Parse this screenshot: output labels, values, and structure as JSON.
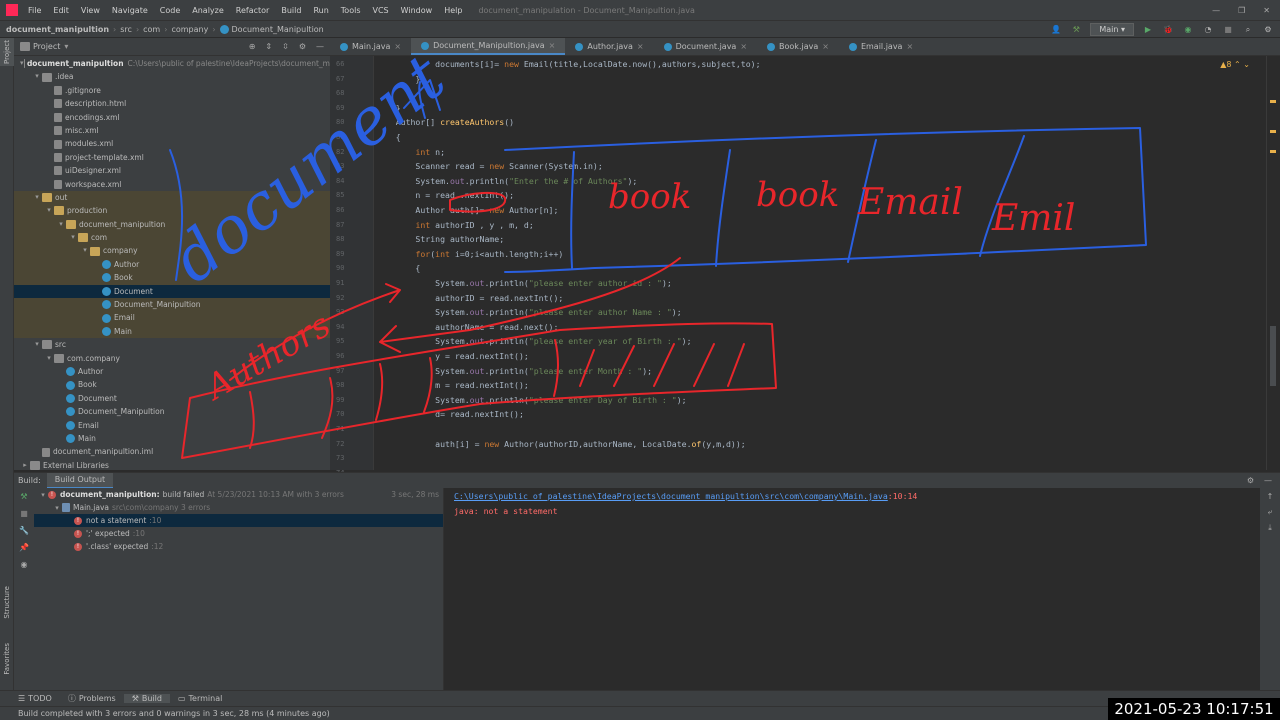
{
  "menu": [
    "File",
    "Edit",
    "View",
    "Navigate",
    "Code",
    "Analyze",
    "Refactor",
    "Build",
    "Run",
    "Tools",
    "VCS",
    "Window",
    "Help"
  ],
  "window_title": "document_manipulation - Document_Manipultion.java",
  "breadcrumbs": [
    "document_manipultion",
    "src",
    "com",
    "company",
    "Document_Manipultion"
  ],
  "run_config": "Main",
  "project_panel": {
    "title": "Project",
    "root_name": "document_manipultion",
    "root_path": "C:\\Users\\public of palestine\\IdeaProjects\\document_m",
    "items": [
      {
        "label": ".idea",
        "depth": 1,
        "kind": "folder",
        "expanded": true
      },
      {
        "label": ".gitignore",
        "depth": 2,
        "kind": "file"
      },
      {
        "label": "description.html",
        "depth": 2,
        "kind": "file"
      },
      {
        "label": "encodings.xml",
        "depth": 2,
        "kind": "file"
      },
      {
        "label": "misc.xml",
        "depth": 2,
        "kind": "file"
      },
      {
        "label": "modules.xml",
        "depth": 2,
        "kind": "file"
      },
      {
        "label": "project-template.xml",
        "depth": 2,
        "kind": "file"
      },
      {
        "label": "uiDesigner.xml",
        "depth": 2,
        "kind": "file"
      },
      {
        "label": "workspace.xml",
        "depth": 2,
        "kind": "file"
      },
      {
        "label": "out",
        "depth": 1,
        "kind": "folder-out",
        "expanded": true
      },
      {
        "label": "production",
        "depth": 2,
        "kind": "folder-out",
        "expanded": true
      },
      {
        "label": "document_manipultion",
        "depth": 3,
        "kind": "folder-out",
        "expanded": true
      },
      {
        "label": "com",
        "depth": 4,
        "kind": "folder-out",
        "expanded": true
      },
      {
        "label": "company",
        "depth": 5,
        "kind": "folder-out",
        "expanded": true
      },
      {
        "label": "Author",
        "depth": 6,
        "kind": "class-out"
      },
      {
        "label": "Book",
        "depth": 6,
        "kind": "class-out"
      },
      {
        "label": "Document",
        "depth": 6,
        "kind": "class-sel"
      },
      {
        "label": "Document_Manipultion",
        "depth": 6,
        "kind": "class-out"
      },
      {
        "label": "Email",
        "depth": 6,
        "kind": "class-out"
      },
      {
        "label": "Main",
        "depth": 6,
        "kind": "class-out"
      },
      {
        "label": "src",
        "depth": 1,
        "kind": "folder",
        "expanded": true
      },
      {
        "label": "com.company",
        "depth": 2,
        "kind": "folder",
        "expanded": true
      },
      {
        "label": "Author",
        "depth": 3,
        "kind": "class"
      },
      {
        "label": "Book",
        "depth": 3,
        "kind": "class"
      },
      {
        "label": "Document",
        "depth": 3,
        "kind": "class"
      },
      {
        "label": "Document_Manipultion",
        "depth": 3,
        "kind": "class"
      },
      {
        "label": "Email",
        "depth": 3,
        "kind": "class"
      },
      {
        "label": "Main",
        "depth": 3,
        "kind": "class"
      },
      {
        "label": "document_manipultion.iml",
        "depth": 1,
        "kind": "file"
      },
      {
        "label": "External Libraries",
        "depth": 0,
        "kind": "folder"
      }
    ]
  },
  "tabs": [
    {
      "label": "Main.java",
      "active": false
    },
    {
      "label": "Document_Manipultion.java",
      "active": true
    },
    {
      "label": "Author.java",
      "active": false
    },
    {
      "label": "Document.java",
      "active": false
    },
    {
      "label": "Book.java",
      "active": false
    },
    {
      "label": "Email.java",
      "active": false
    }
  ],
  "inspection": "8",
  "line_numbers": [
    "66",
    "67",
    "68",
    "69",
    "80",
    "81",
    "82",
    "83",
    "84",
    "85",
    "86",
    "87",
    "88",
    "89",
    "90",
    "91",
    "92",
    "93",
    "94",
    "95",
    "96",
    "97",
    "98",
    "99",
    "70",
    "71",
    "72",
    "73",
    "74",
    "75",
    "76",
    "77"
  ],
  "code_lines": [
    {
      "i": 0,
      "t": "            documents[i]= new Email(title,LocalDate.now(),authors,subject,to);"
    },
    {
      "i": 1,
      "t": "        }"
    },
    {
      "i": 3,
      "t": "    }"
    },
    {
      "i": 4,
      "t": "    Author[] createAuthors()"
    },
    {
      "i": 5,
      "t": "    {"
    },
    {
      "i": 6,
      "t": "        int n;"
    },
    {
      "i": 7,
      "t": "        Scanner read = new Scanner(System.in);"
    },
    {
      "i": 8,
      "t": "        System.out.println(\"Enter the # of Authors\");"
    },
    {
      "i": 9,
      "t": "        n = read .nextInt();"
    },
    {
      "i": 10,
      "t": "        Author auth[]= new Author[n];"
    },
    {
      "i": 11,
      "t": "        int authorID , y , m, d;"
    },
    {
      "i": 12,
      "t": "        String authorName;"
    },
    {
      "i": 13,
      "t": "        for(int i=0;i<auth.length;i++)"
    },
    {
      "i": 14,
      "t": "        {"
    },
    {
      "i": 15,
      "t": "            System.out.println(\"please enter author id : \");"
    },
    {
      "i": 16,
      "t": "            authorID = read.nextInt();"
    },
    {
      "i": 17,
      "t": "            System.out.println(\"please enter author Name : \");"
    },
    {
      "i": 18,
      "t": "            authorName = read.next();"
    },
    {
      "i": 19,
      "t": "            System.out.println(\"please enter year of Birth : \");"
    },
    {
      "i": 20,
      "t": "            y = read.nextInt();"
    },
    {
      "i": 21,
      "t": "            System.out.println(\"please enter Month : \");"
    },
    {
      "i": 22,
      "t": "            m = read.nextInt();"
    },
    {
      "i": 23,
      "t": "            System.out.println(\"please enter Day of Birth : \");"
    },
    {
      "i": 24,
      "t": "            d= read.nextInt();"
    },
    {
      "i": 26,
      "t": "            auth[i] = new Author(authorID,authorName, LocalDate.of(y,m,d));"
    }
  ],
  "build": {
    "tab_label": "Build:",
    "output_tab": "Build Output",
    "root_label": "document_manipultion:",
    "root_status": "build failed",
    "root_detail": "At 5/23/2021 10:13 AM with 3 errors",
    "root_time": "3 sec, 28 ms",
    "file_label": "Main.java",
    "file_path": "src\\com\\company 3 errors",
    "errors": [
      {
        "msg": "not a statement",
        "loc": ":10"
      },
      {
        "msg": "';' expected",
        "loc": ":10"
      },
      {
        "msg": "'.class' expected",
        "loc": ":12"
      }
    ],
    "output_path": "C:\\Users\\public of palestine\\IdeaProjects\\document_manipultion\\src\\com\\company\\Main.java",
    "output_loc": ":10:14",
    "output_msg": "java: not a statement"
  },
  "toolwindows": [
    "TODO",
    "Problems",
    "Build",
    "Terminal"
  ],
  "status": "Build completed with 3 errors and 0 warnings in 3 sec, 28 ms (4 minutes ago)",
  "timestamp": "2021-05-23  10:17:51",
  "side_labels": {
    "project": "Project",
    "structure": "Structure",
    "favorites": "Favorites"
  },
  "annotations": {
    "word_document": "document",
    "cells_top": [
      "book",
      "book",
      "Email",
      "Emil"
    ],
    "word_authors": "Authors"
  },
  "colors": {
    "ink_red": "#e8262b",
    "ink_blue": "#2a5fe0",
    "accent": "#4a88c7",
    "error": "#c75450"
  }
}
